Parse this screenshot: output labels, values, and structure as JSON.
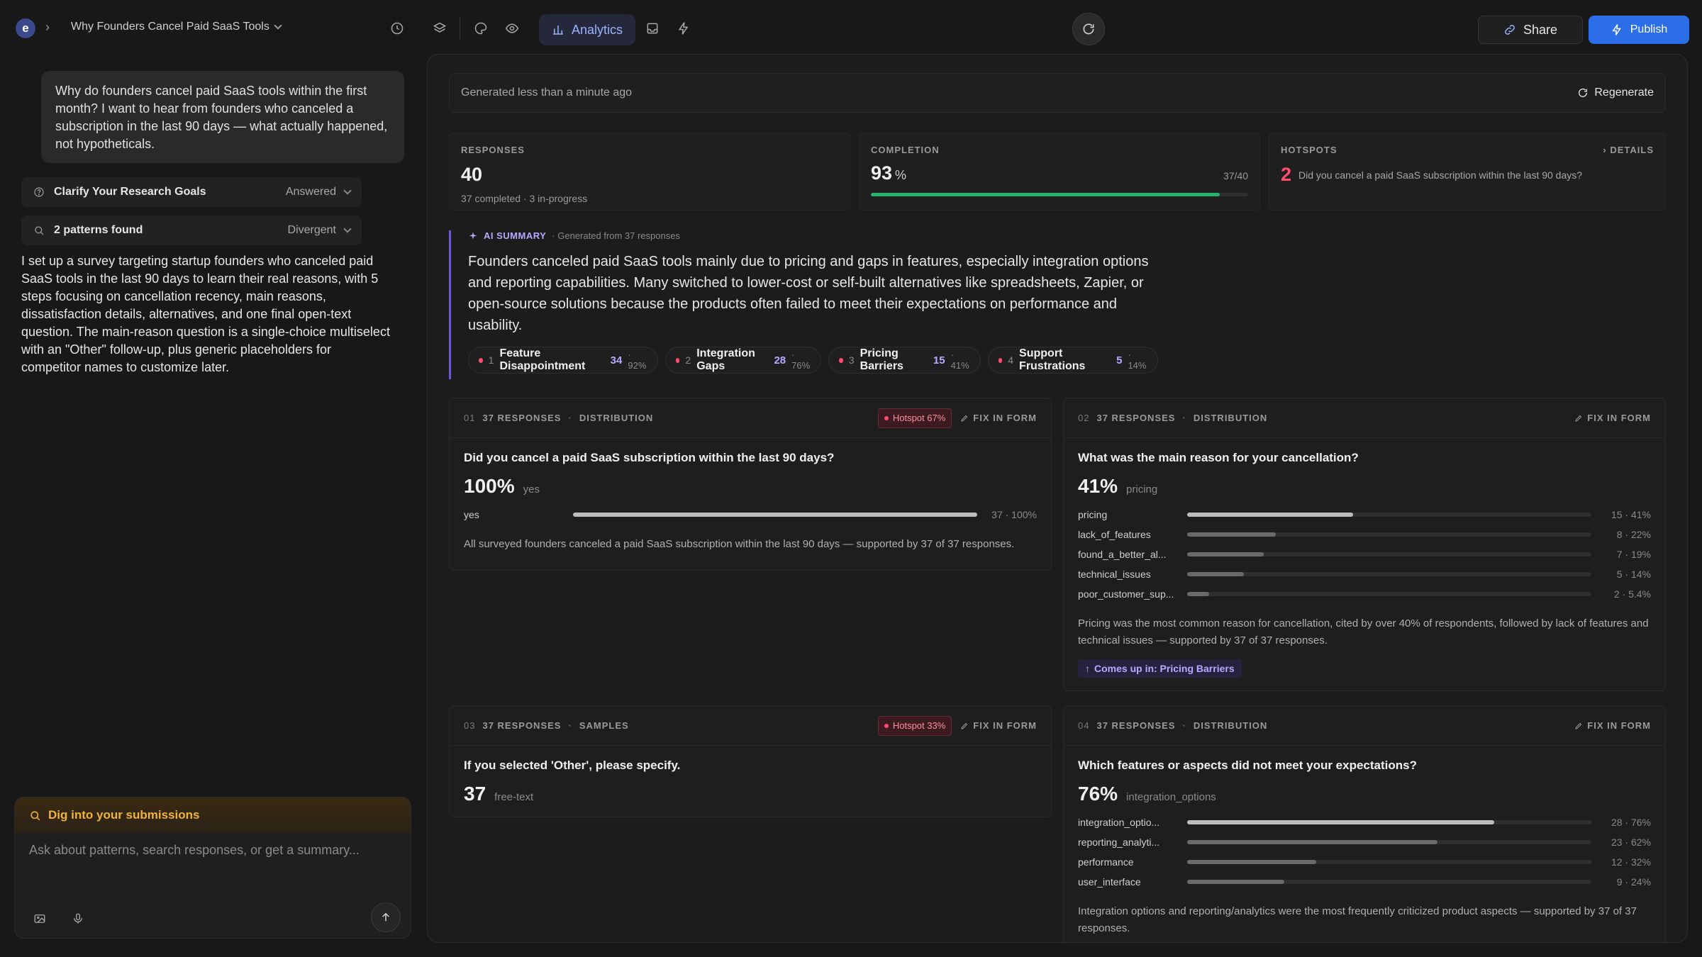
{
  "header": {
    "project_title": "Why Founders Cancel Paid SaaS Tools",
    "active_tab": "Analytics",
    "share_label": "Share",
    "publish_label": "Publish"
  },
  "left": {
    "prompt": "Why do founders cancel paid SaaS tools within the first month? I want to hear from founders who canceled a subscription in the last 90 days — what actually happened, not hypotheticals.",
    "steps": [
      {
        "label": "Clarify Your Research Goals",
        "status": "Answered",
        "icon": "help-circle-icon"
      },
      {
        "label": "2 patterns found",
        "status": "Divergent",
        "icon": "search-icon"
      }
    ],
    "agent_message": "I set up a survey targeting startup founders who canceled paid SaaS tools in the last 90 days to learn their real reasons, with 5 steps focusing on cancellation recency, main reasons, dissatisfaction details, alternatives, and one final open-text question. The main-reason question is a single-choice multiselect with an \"Other\" follow-up, plus generic placeholders for competitor names to customize later.",
    "chat": {
      "header": "Dig into your submissions",
      "placeholder": "Ask about patterns, search responses, or get a summary..."
    }
  },
  "main": {
    "generated": "Generated less than a minute ago",
    "regenerate_label": "Regenerate",
    "stats": {
      "responses": {
        "label": "RESPONSES",
        "value": "40",
        "sub": "37 completed · 3 in-progress"
      },
      "completion": {
        "label": "COMPLETION",
        "value": "93",
        "unit": "%",
        "fraction": "37/40",
        "progress": 0.925
      },
      "hotspots": {
        "label": "HOTSPOTS",
        "details": "DETAILS",
        "count": "2",
        "question": "Did you cancel a paid SaaS subscription within the last 90 days?"
      }
    },
    "ai_summary": {
      "label": "AI SUMMARY",
      "generated_from": "· Generated from 37 responses",
      "text": "Founders canceled paid SaaS tools mainly due to pricing and gaps in features, especially integration options and reporting capabilities. Many switched to lower-cost or self-built alternatives like spreadsheets, Zapier, or open-source solutions because the products often failed to meet their expectations on performance and usability.",
      "themes": [
        {
          "idx": "1",
          "name": "Feature Disappointment",
          "count": "34",
          "pct": "· 92%"
        },
        {
          "idx": "2",
          "name": "Integration Gaps",
          "count": "28",
          "pct": "· 76%"
        },
        {
          "idx": "3",
          "name": "Pricing Barriers",
          "count": "15",
          "pct": "· 41%"
        },
        {
          "idx": "4",
          "name": "Support Frustrations",
          "count": "5",
          "pct": "· 14%"
        }
      ]
    },
    "questions": [
      {
        "num": "01",
        "responses": "37 RESPONSES",
        "kind": "DISTRIBUTION",
        "hotspot": "Hotspot 67%",
        "fix": "FIX IN FORM",
        "title": "Did you cancel a paid SaaS subscription within the last 90 days?",
        "big_value": "100%",
        "big_label": "yes",
        "rows": [
          {
            "label": "yes",
            "value": "37 · 100%",
            "fraction": 1.0
          }
        ],
        "description": "All surveyed founders canceled a paid SaaS subscription within the last 90 days — supported by 37 of 37 responses."
      },
      {
        "num": "02",
        "responses": "37 RESPONSES",
        "kind": "DISTRIBUTION",
        "fix": "FIX IN FORM",
        "title": "What was the main reason for your cancellation?",
        "big_value": "41%",
        "big_label": "pricing",
        "rows": [
          {
            "label": "pricing",
            "value": "15 · 41%",
            "fraction": 0.41
          },
          {
            "label": "lack_of_features",
            "value": "8 · 22%",
            "fraction": 0.22
          },
          {
            "label": "found_a_better_al...",
            "value": "7 · 19%",
            "fraction": 0.19
          },
          {
            "label": "technical_issues",
            "value": "5 · 14%",
            "fraction": 0.14
          },
          {
            "label": "poor_customer_sup...",
            "value": "2 · 5.4%",
            "fraction": 0.054
          }
        ],
        "description": "Pricing was the most common reason for cancellation, cited by over 40% of respondents, followed by lack of features and technical issues — supported by 37 of 37 responses.",
        "appears_in": "Comes up in: Pricing Barriers"
      },
      {
        "num": "03",
        "responses": "37 RESPONSES",
        "kind": "SAMPLES",
        "hotspot": "Hotspot 33%",
        "fix": "FIX IN FORM",
        "title": "If you selected 'Other', please specify.",
        "big_value": "37",
        "big_label": "free-text"
      },
      {
        "num": "04",
        "responses": "37 RESPONSES",
        "kind": "DISTRIBUTION",
        "fix": "FIX IN FORM",
        "title": "Which features or aspects did not meet your expectations?",
        "big_value": "76%",
        "big_label": "integration_options",
        "rows": [
          {
            "label": "integration_optio...",
            "value": "28 · 76%",
            "fraction": 0.76
          },
          {
            "label": "reporting_analyti...",
            "value": "23 · 62%",
            "fraction": 0.62
          },
          {
            "label": "performance",
            "value": "12 · 32%",
            "fraction": 0.32
          },
          {
            "label": "user_interface",
            "value": "9 · 24%",
            "fraction": 0.24
          }
        ],
        "description": "Integration options and reporting/analytics were the most frequently criticized product aspects — supported by 37 of 37 responses."
      }
    ]
  },
  "colors": {
    "accent_blue": "#2c6ee8",
    "hotspot_red": "#ff4d6d",
    "summary_purple": "#b9a8ff",
    "completion_green": "#25b36b"
  }
}
